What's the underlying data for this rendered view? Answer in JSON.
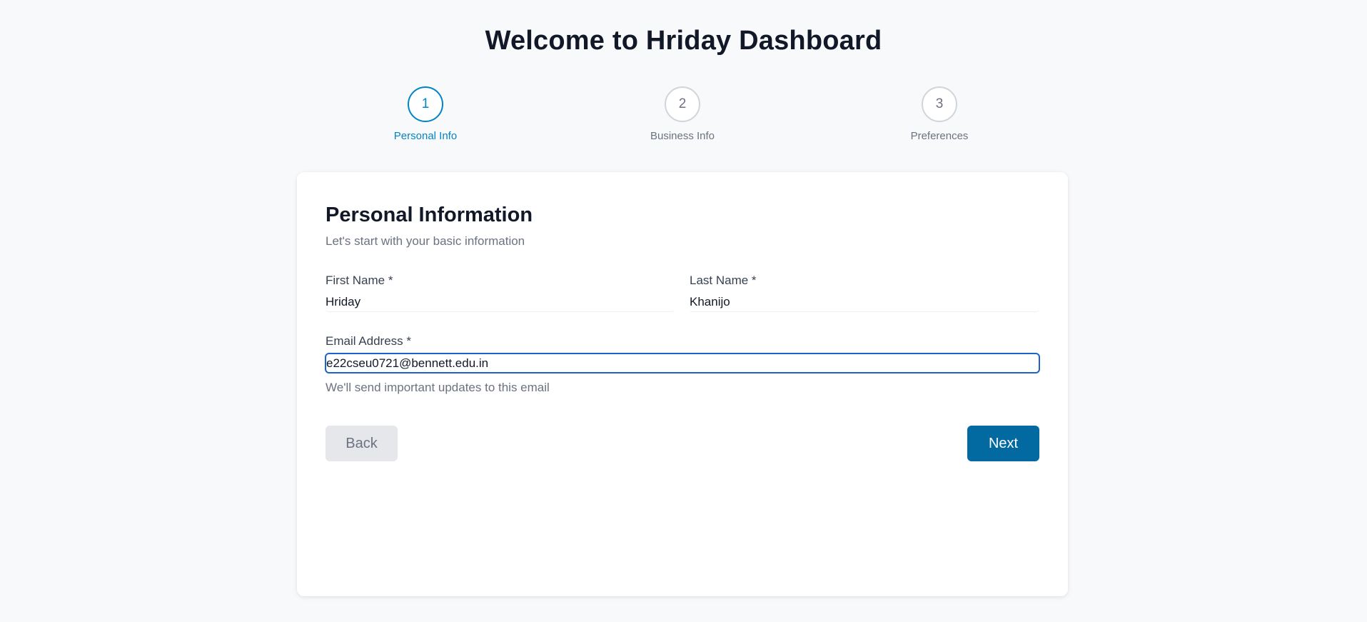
{
  "header": {
    "title": "Welcome to Hriday Dashboard"
  },
  "stepper": {
    "active_step": 1,
    "steps": [
      {
        "number": "1",
        "label": "Personal Info"
      },
      {
        "number": "2",
        "label": "Business Info"
      },
      {
        "number": "3",
        "label": "Preferences"
      }
    ]
  },
  "form": {
    "title": "Personal Information",
    "subtitle": "Let's start with your basic information",
    "first_name": {
      "label": "First Name *",
      "value": "Hriday"
    },
    "last_name": {
      "label": "Last Name *",
      "value": "Khanijo"
    },
    "email": {
      "label": "Email Address *",
      "value": "e22cseu0721@bennett.edu.in",
      "hint": "We'll send important updates to this email"
    }
  },
  "actions": {
    "back_label": "Back",
    "next_label": "Next"
  },
  "colors": {
    "accent": "#0284c7",
    "primary_button": "#0369a1",
    "focus_border": "#1d63c9",
    "disabled_button": "#e5e7eb"
  }
}
